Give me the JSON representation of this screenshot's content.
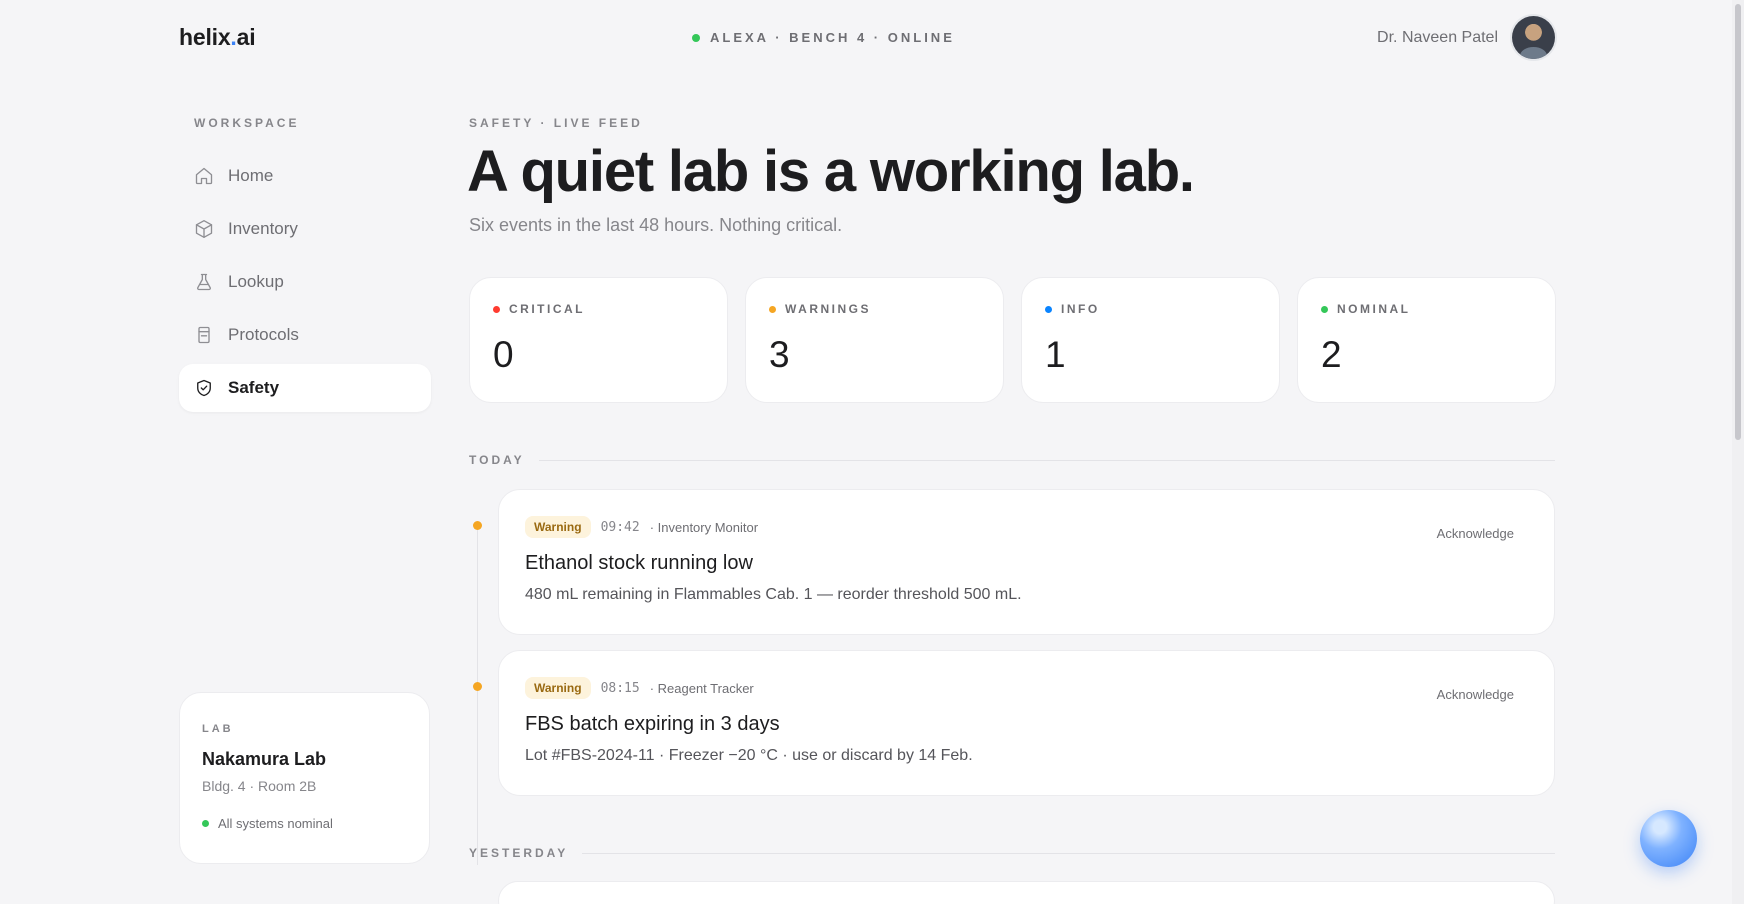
{
  "brand": {
    "name_main": "helix",
    "name_dot": ".",
    "name_suffix": "ai"
  },
  "status": {
    "text": "ALEXA · BENCH 4 · ONLINE"
  },
  "user": {
    "name": "Dr. Naveen Patel"
  },
  "sidebar": {
    "section_label": "WORKSPACE",
    "items": [
      {
        "label": "Home",
        "icon": "home-icon",
        "active": false
      },
      {
        "label": "Inventory",
        "icon": "box-icon",
        "active": false
      },
      {
        "label": "Lookup",
        "icon": "flask-icon",
        "active": false
      },
      {
        "label": "Protocols",
        "icon": "clipboard-icon",
        "active": false
      },
      {
        "label": "Safety",
        "icon": "shield-icon",
        "active": true
      }
    ],
    "lab": {
      "label": "LAB",
      "name": "Nakamura Lab",
      "location": "Bldg. 4 · Room 2B",
      "status": "All systems nominal"
    }
  },
  "main": {
    "eyebrow": "SAFETY · LIVE FEED",
    "headline": "A quiet lab is a working lab.",
    "subhead": "Six events in the last 48 hours. Nothing critical.",
    "stats": [
      {
        "label": "CRITICAL",
        "value": "0",
        "color": "#ff3b30"
      },
      {
        "label": "WARNINGS",
        "value": "3",
        "color": "#f5a623"
      },
      {
        "label": "INFO",
        "value": "1",
        "color": "#0a84ff"
      },
      {
        "label": "NOMINAL",
        "value": "2",
        "color": "#34c759"
      }
    ],
    "groups": {
      "today": "TODAY",
      "yesterday": "YESTERDAY"
    },
    "events": [
      {
        "badge": "Warning",
        "time": "09:42",
        "source": "· Inventory Monitor",
        "title": "Ethanol stock running low",
        "description": "480 mL remaining in Flammables Cab. 1 — reorder threshold 500 mL.",
        "action": "Acknowledge"
      },
      {
        "badge": "Warning",
        "time": "08:15",
        "source": "· Reagent Tracker",
        "title": "FBS batch expiring in 3 days",
        "description": "Lot #FBS-2024-11 · Freezer −20 °C · use or discard by 14 Feb.",
        "action": "Acknowledge"
      }
    ]
  }
}
